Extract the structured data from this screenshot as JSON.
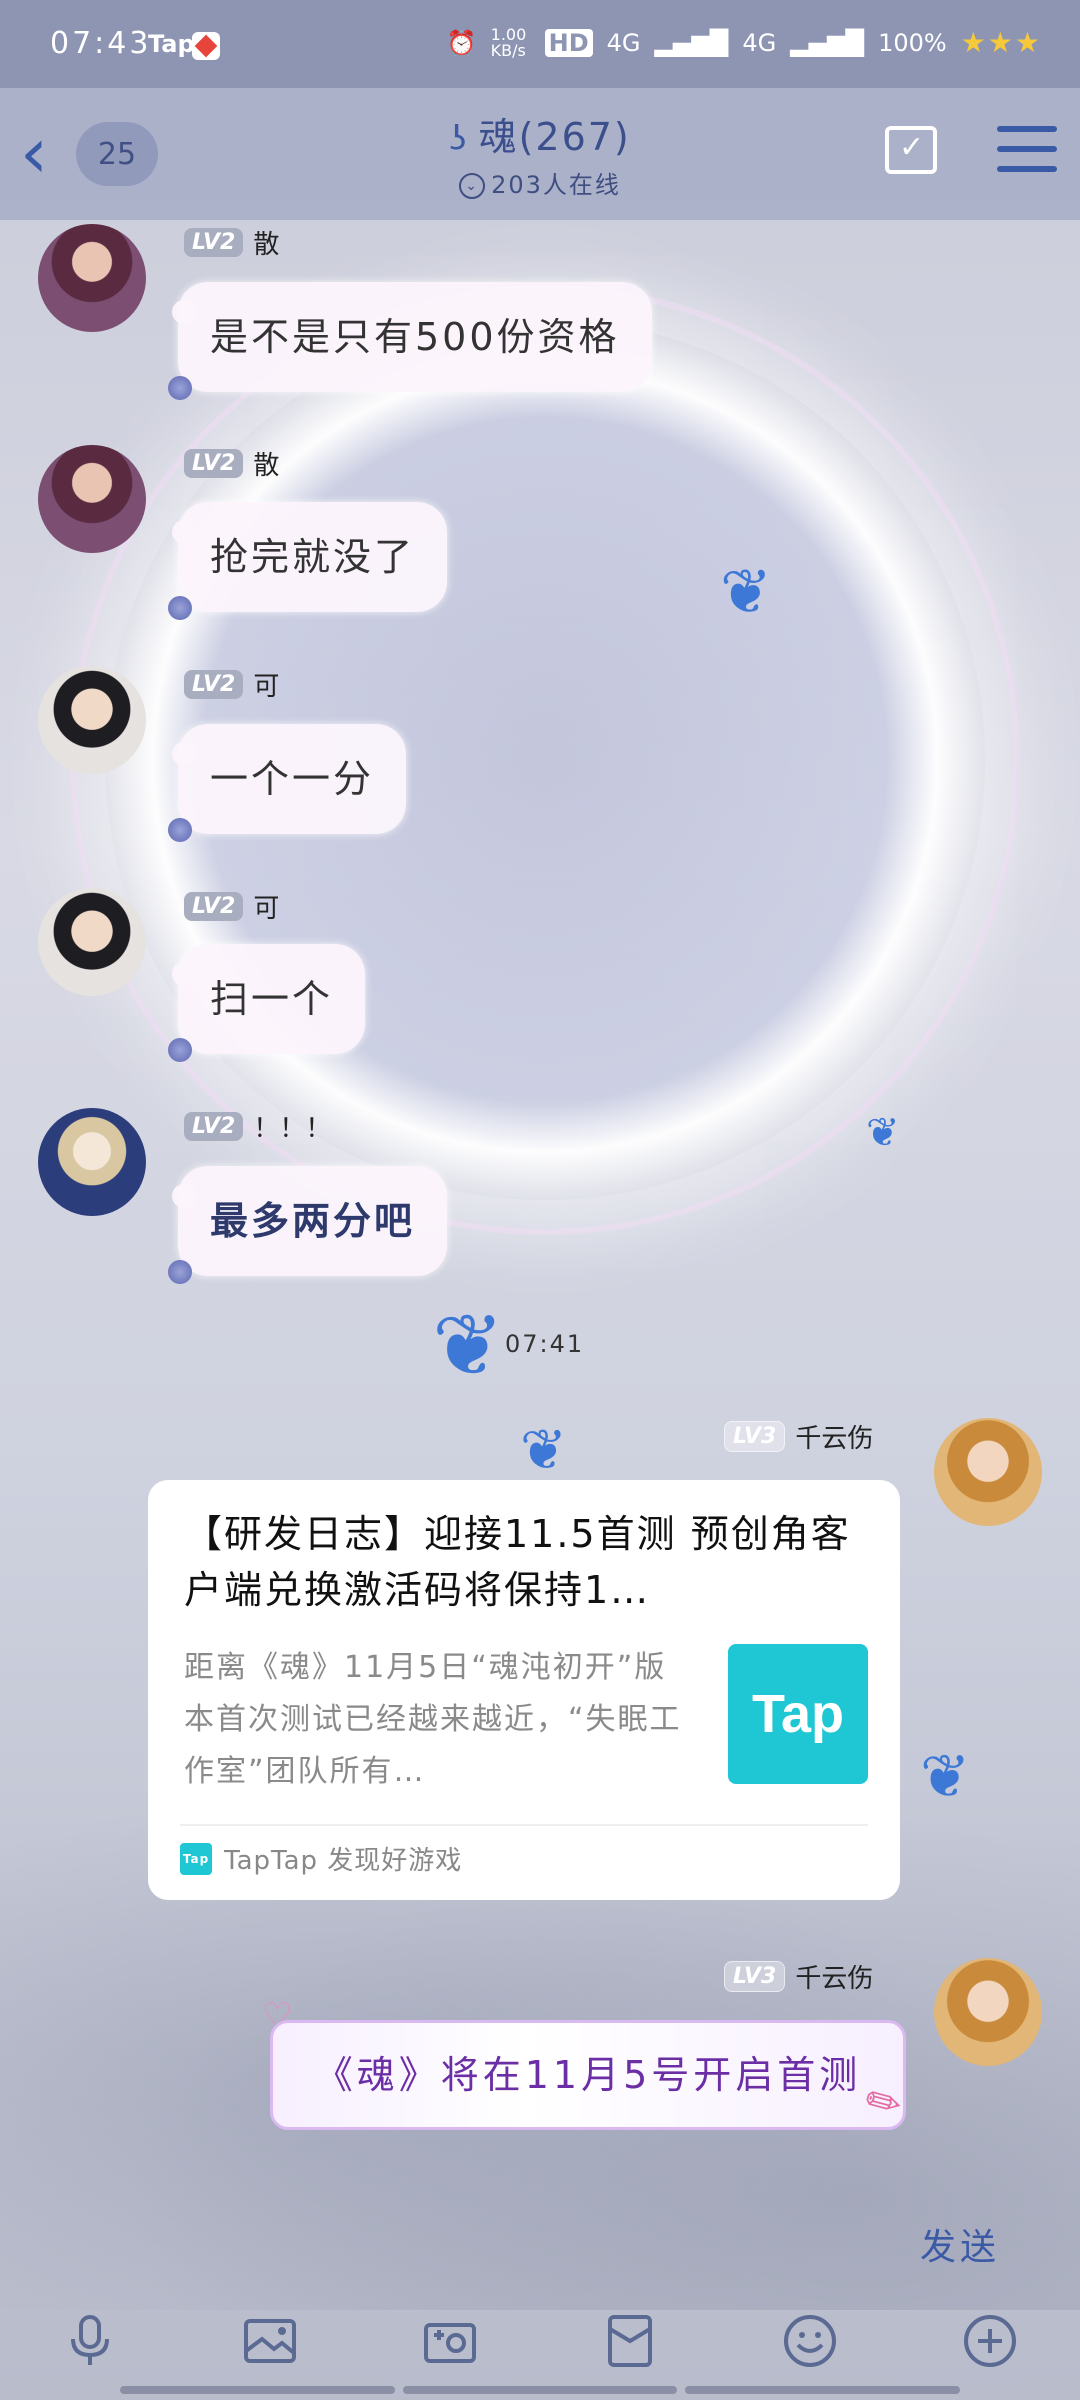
{
  "status_bar": {
    "time": "07:43",
    "app_label": "Tap",
    "network_speed": "1.00 KB/s",
    "hd": "HD",
    "net1": "4G",
    "net2": "4G",
    "battery": "100%"
  },
  "header": {
    "unread_count": "25",
    "title": "魂(267)",
    "online": "203人在线"
  },
  "messages": [
    {
      "level": "LV2",
      "name": "散",
      "text": "是不是只有500份资格"
    },
    {
      "level": "LV2",
      "name": "散",
      "text": "抢完就没了"
    },
    {
      "level": "LV2",
      "name": "可",
      "text": "一个一分"
    },
    {
      "level": "LV2",
      "name": "可",
      "text": "扫一个"
    },
    {
      "level": "LV2",
      "name": "！！！",
      "text": "最多两分吧"
    }
  ],
  "timestamp": "07:41",
  "share_card": {
    "level": "LV3",
    "name": "千云伤",
    "title": "【研发日志】迎接11.5首测 预创角客户端兑换激活码将保持1…",
    "description": "距离《魂》11月5日“魂沌初开”版本首次测试已经越来越近，“失眠工作室”团队所有…",
    "logo_text": "Tap",
    "source_icon": "Tap",
    "source": "TapTap 发现好游戏"
  },
  "fancy_message": {
    "level": "LV3",
    "name": "千云伤",
    "text": "《魂》将在11月5号开启首测"
  },
  "input": {
    "send_label": "发送"
  },
  "colors": {
    "accent": "#3b5aa6",
    "tap_brand": "#1ec7d3",
    "fancy_text": "#6c2ea5"
  }
}
